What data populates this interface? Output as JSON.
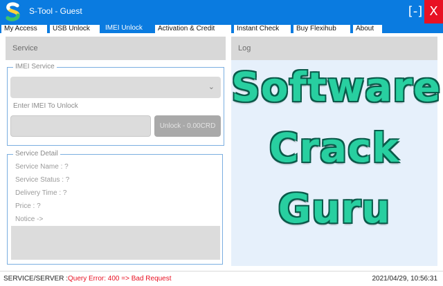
{
  "window": {
    "title": "S-Tool - Guest",
    "minimize_label": "[-]",
    "close_label": "X"
  },
  "tabs": [
    {
      "label": "My Access",
      "active": false
    },
    {
      "label": "USB Unlock",
      "active": false
    },
    {
      "label": "IMEI Unlock",
      "active": true
    },
    {
      "label": "Activation & Credit",
      "active": false
    },
    {
      "label": "Instant Check",
      "active": false
    },
    {
      "label": "Buy Flexihub",
      "active": false
    },
    {
      "label": "About",
      "active": false
    }
  ],
  "service_panel": {
    "header": "Service",
    "imei_service": {
      "group_label": "IMEI Service",
      "select_value": "",
      "enter_label": "Enter IMEI To Unlock",
      "imei_value": "",
      "unlock_button": "Unlock - 0.00CRD"
    },
    "service_detail": {
      "group_label": "Service Detail",
      "name": "Service Name : ?",
      "status": "Service Status : ?",
      "delivery": "Delivery Time : ?",
      "price": "Price : ?",
      "notice": "Notice ->",
      "notice_value": ""
    }
  },
  "log_panel": {
    "header": "Log",
    "watermark": [
      "Software",
      "Crack",
      "Guru"
    ]
  },
  "status_bar": {
    "label": "SERVICE/SERVER :",
    "error": "Query Error: 400 => Bad Request",
    "timestamp": "2021/04/29, 10:56:31"
  },
  "colors": {
    "titlebar": "#0a7be0",
    "close": "#e81123",
    "watermark": "#28cfa0",
    "error_text": "#e81123"
  }
}
